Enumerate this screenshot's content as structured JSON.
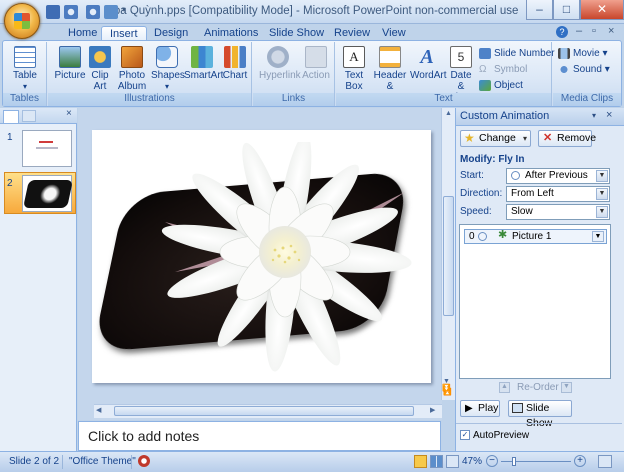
{
  "window": {
    "title": "Hoa Quỳnh.pps [Compatibility Mode] - Microsoft PowerPoint non-commercial use",
    "controls": [
      "–",
      "□",
      "✕"
    ]
  },
  "tabs": [
    {
      "label": "Home"
    },
    {
      "label": "Insert"
    },
    {
      "label": "Design"
    },
    {
      "label": "Animations"
    },
    {
      "label": "Slide Show"
    },
    {
      "label": "Review"
    },
    {
      "label": "View"
    }
  ],
  "ribbon": {
    "groups": {
      "tables": "Tables",
      "illustrations": "Illustrations",
      "links": "Links",
      "text": "Text",
      "media": "Media Clips"
    },
    "table": "Table",
    "picture": "Picture",
    "clip_art": [
      "Clip",
      "Art"
    ],
    "photo_album": [
      "Photo",
      "Album ▾"
    ],
    "shapes": "Shapes",
    "smartart": "SmartArt",
    "chart": "Chart",
    "hyperlink": "Hyperlink",
    "action": "Action",
    "text_box": [
      "Text",
      "Box"
    ],
    "header_footer": [
      "Header",
      "& Footer"
    ],
    "wordart": "WordArt",
    "date_time": [
      "Date",
      "& Time"
    ],
    "slide_number": "Slide Number",
    "symbol": "Symbol",
    "object": "Object",
    "movie": "Movie ▾",
    "sound": "Sound ▾"
  },
  "slides_panel": {
    "numbers": [
      "1",
      "2"
    ]
  },
  "notes_placeholder": "Click to add notes",
  "task_pane": {
    "title": "Custom Animation",
    "change": "Change",
    "remove": "Remove",
    "modify": "Modify: Fly In",
    "start_label": "Start:",
    "start_value": "After Previous",
    "direction_label": "Direction:",
    "direction_value": "From Left",
    "speed_label": "Speed:",
    "speed_value": "Slow",
    "item_index": "0",
    "item_name": "Picture 1",
    "reorder": "Re-Order",
    "play": "Play",
    "slide_show": "Slide Show",
    "autopreview": "AutoPreview"
  },
  "status": {
    "slide": "Slide 2 of 2",
    "theme": "\"Office Theme\"",
    "zoom": "47%"
  },
  "colors": {
    "ribbon_text": "#15428b",
    "accent": "#f7a93c",
    "frame": "#bfd3ea"
  }
}
